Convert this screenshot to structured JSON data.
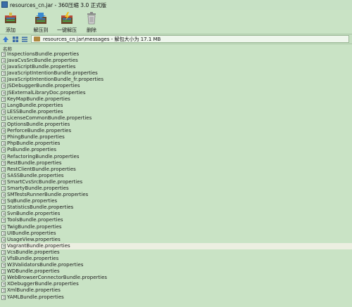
{
  "window": {
    "title": "resources_cn.jar - 360压缩 3.0 正式版"
  },
  "toolbar": {
    "add_label": "添加",
    "extract_to_label": "解压到",
    "one_click_extract_label": "一键解压",
    "delete_label": "删除"
  },
  "address": {
    "path": "resources_cn.jar\\messages - 解包大小为 17.1 MB"
  },
  "header": {
    "name_column": "名称"
  },
  "files": [
    "InspectionsBundle.properties",
    "JavaCvsSrcBundle.properties",
    "JavaScriptBundle.properties",
    "JavaScriptIntentionBundle.properties",
    "JavaScriptIntentionBundle_fr.properties",
    "JSDebuggerBundle.properties",
    "JSExternalLibraryDoc.properties",
    "KeyMapBundle.properties",
    "LangBundle.properties",
    "LESSBundle.properties",
    "LicenseCommonBundle.properties",
    "OptionsBundle.properties",
    "PerforceBundle.properties",
    "PhingBundle.properties",
    "PhpBundle.properties",
    "PsBundle.properties",
    "RefactoringBundle.properties",
    "RestBundle.properties",
    "RestClientBundle.properties",
    "SASSBundle.properties",
    "SmartCvsSrcBundle.properties",
    "SmartyBundle.properties",
    "SMTestsRunnerBundle.properties",
    "SqBundle.properties",
    "StatisticsBundle.properties",
    "SvnBundle.properties",
    "ToolsBundle.properties",
    "TwigBundle.properties",
    "UIBundle.properties",
    "UsageView.properties",
    "VagrantBundle.properties",
    "VcsBundle.properties",
    "VfsBundle.properties",
    "W3ValidatorsBundle.properties",
    "WDBundle.properties",
    "WebBrowserConnectorBundle.properties",
    "XDebuggerBundle.properties",
    "XmlBundle.properties",
    "YAMLBundle.properties"
  ],
  "selected_file": "VagrantBundle.properties"
}
